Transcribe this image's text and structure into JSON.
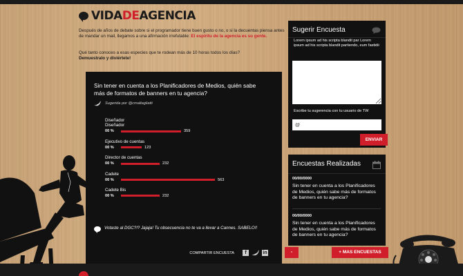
{
  "logo": {
    "part1": "VIDA",
    "part2": "DE",
    "part3": "AGENCIA"
  },
  "intro": {
    "text": "Después de años de debate sobre si el programador tiene buen gusto o no, o si la decuentas piensa antes de mandar un mail, llegamos a una afirmación irrefutable:",
    "highlight": "El espíritu de la agencia es su gente.",
    "question": "Qué tanto conoces a esas especies que te rodean más de 10 horas todos los días?",
    "cta": "Demuestralo y diviértete!"
  },
  "poll": {
    "question": "Sin tener en cuenta a los Planificadores de Medios, quién sabe más de formatos de banners en tu agencia?",
    "suggested_by": "Sugerida por @cmaltagliatti",
    "options": [
      {
        "label": "Diseñador\nDiseñador",
        "pct": "00 %",
        "count": "359",
        "value": 359
      },
      {
        "label": "Ejecutivo de cuentas",
        "pct": "00 %",
        "count": "123",
        "value": 123
      },
      {
        "label": "Director de cuentas",
        "pct": "00 %",
        "count": "232",
        "value": 232
      },
      {
        "label": "Cadete",
        "pct": "00 %",
        "count": "563",
        "value": 563
      },
      {
        "label": "Cadete Bis",
        "pct": "00 %",
        "count": "232",
        "value": 232
      }
    ],
    "comment": "Votaste al DGC?!? Jajaja! Tu obsecuencia no te va a llevar a Cannes. SABELO!!",
    "share_label": "COMPARTIR ENCUESTA",
    "share_icons": [
      "facebook-icon",
      "twitter-icon",
      "linkedin-icon"
    ]
  },
  "suggest": {
    "title": "Sugerir Encuesta",
    "text": "Lorem ipsum ad his scripta blandit par Lorem ipsum ad his scripta blandit partiendo, eum fastidii",
    "tw_label": "Escribe tu sugerencia con tu usuario de TW",
    "tw_value": "@",
    "send_label": "ENVIAR"
  },
  "surveys": {
    "title": "Encuestas Realizadas",
    "items": [
      {
        "date": "00/00/0000",
        "question": "Sin tener en cuenta a los Planificadores de Medios, quién sabe más de formatos de banners en tu agencia?"
      },
      {
        "date": "00/00/0000",
        "question": "Sin tener en cuenta a los Planificadores de Medios, quién sabe más de formatos de banners en tu agencia?"
      }
    ],
    "minus_label": "-",
    "more_label": "+  MAS ENCUESTAS"
  },
  "colors": {
    "accent": "#d01f2b",
    "panel": "#111111",
    "wood": "#cfa97d"
  }
}
